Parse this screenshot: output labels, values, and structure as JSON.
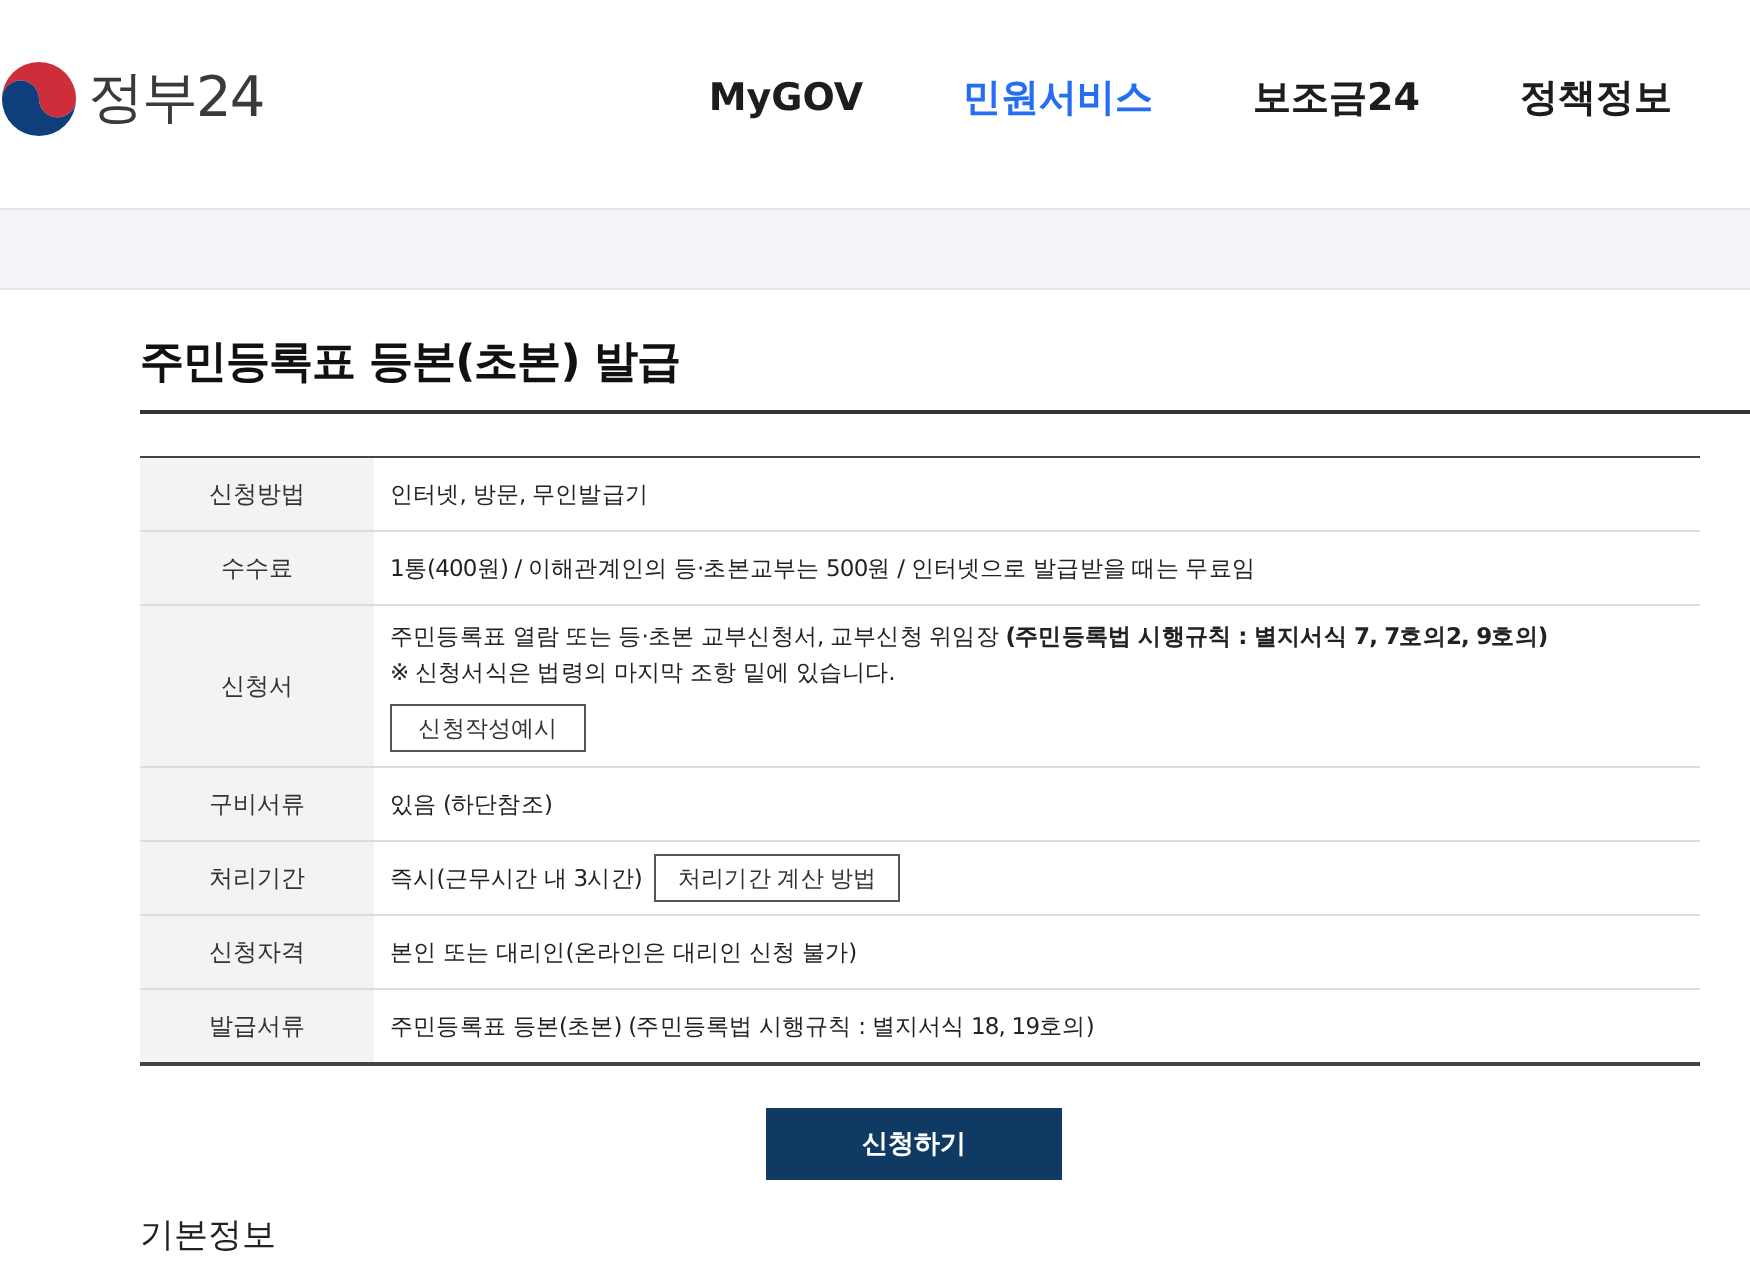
{
  "header": {
    "logo": "정부24",
    "nav": [
      {
        "label": "MyGOV",
        "selected": false
      },
      {
        "label": "민원서비스",
        "selected": true
      },
      {
        "label": "보조금24",
        "selected": false
      },
      {
        "label": "정책정보",
        "selected": false
      }
    ]
  },
  "page": {
    "title": "주민등록표 등본(초본) 발급"
  },
  "info_table": {
    "rows": [
      {
        "kind": "plain",
        "label": "신청방법",
        "lines": [
          "인터넷, 방문, 무인발급기"
        ]
      },
      {
        "kind": "plain",
        "label": "수수료",
        "lines": [
          "1통(400원) / 이해관계인의 등·초본교부는 500원 / 인터넷으로 발급받을 때는 무료임"
        ]
      },
      {
        "kind": "button_below",
        "label": "신청서",
        "lines": [
          "주민등록표 열람 또는 등·초본 교부신청서, 교부신청 위임장 **(주민등록법 시행규칙 : 별지서식 7, 7호의2, 9호의)**",
          "※ 신청서식은 법령의 마지막 조항 밑에 있습니다."
        ],
        "button": "신청작성예시"
      },
      {
        "kind": "plain",
        "label": "구비서류",
        "lines": [
          "있음 (하단참조)"
        ]
      },
      {
        "kind": "button_inline",
        "label": "처리기간",
        "lines": [
          "즉시(근무시간 내 3시간)"
        ],
        "button": "처리기간 계산 방법"
      },
      {
        "kind": "plain",
        "label": "신청자격",
        "lines": [
          "본인 또는 대리인(온라인은 대리인 신청 불가)"
        ]
      },
      {
        "kind": "plain",
        "label": "발급서류",
        "lines": [
          "주민등록표 등본(초본) (주민등록법 시행규칙 : 별지서식 18, 19호의)"
        ]
      }
    ]
  },
  "apply_button": "신청하기",
  "section_heading": "기본정보"
}
